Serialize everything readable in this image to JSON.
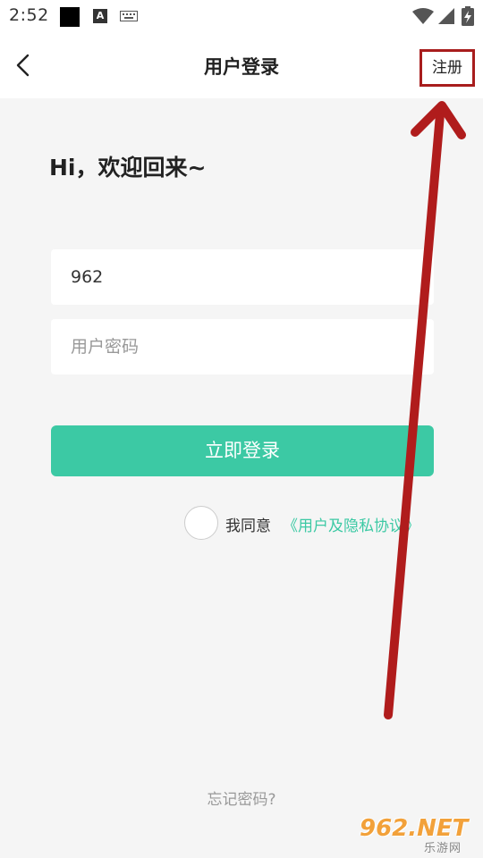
{
  "status_bar": {
    "time": "2:52",
    "a_icon_letter": "A"
  },
  "nav": {
    "title": "用户登录",
    "register_label": "注册"
  },
  "welcome": "Hi，欢迎回来~",
  "form": {
    "username_value": "962",
    "password_placeholder": "用户密码"
  },
  "login_button": "立即登录",
  "agreement": {
    "prefix": "我同意",
    "link": "《用户及隐私协议》"
  },
  "forgot_password": "忘记密码?",
  "watermark": {
    "main": "962.NET",
    "sub": "乐游网"
  },
  "colors": {
    "accent": "#3cc9a4",
    "annotation": "#b01c1c",
    "background": "#f5f5f5"
  }
}
